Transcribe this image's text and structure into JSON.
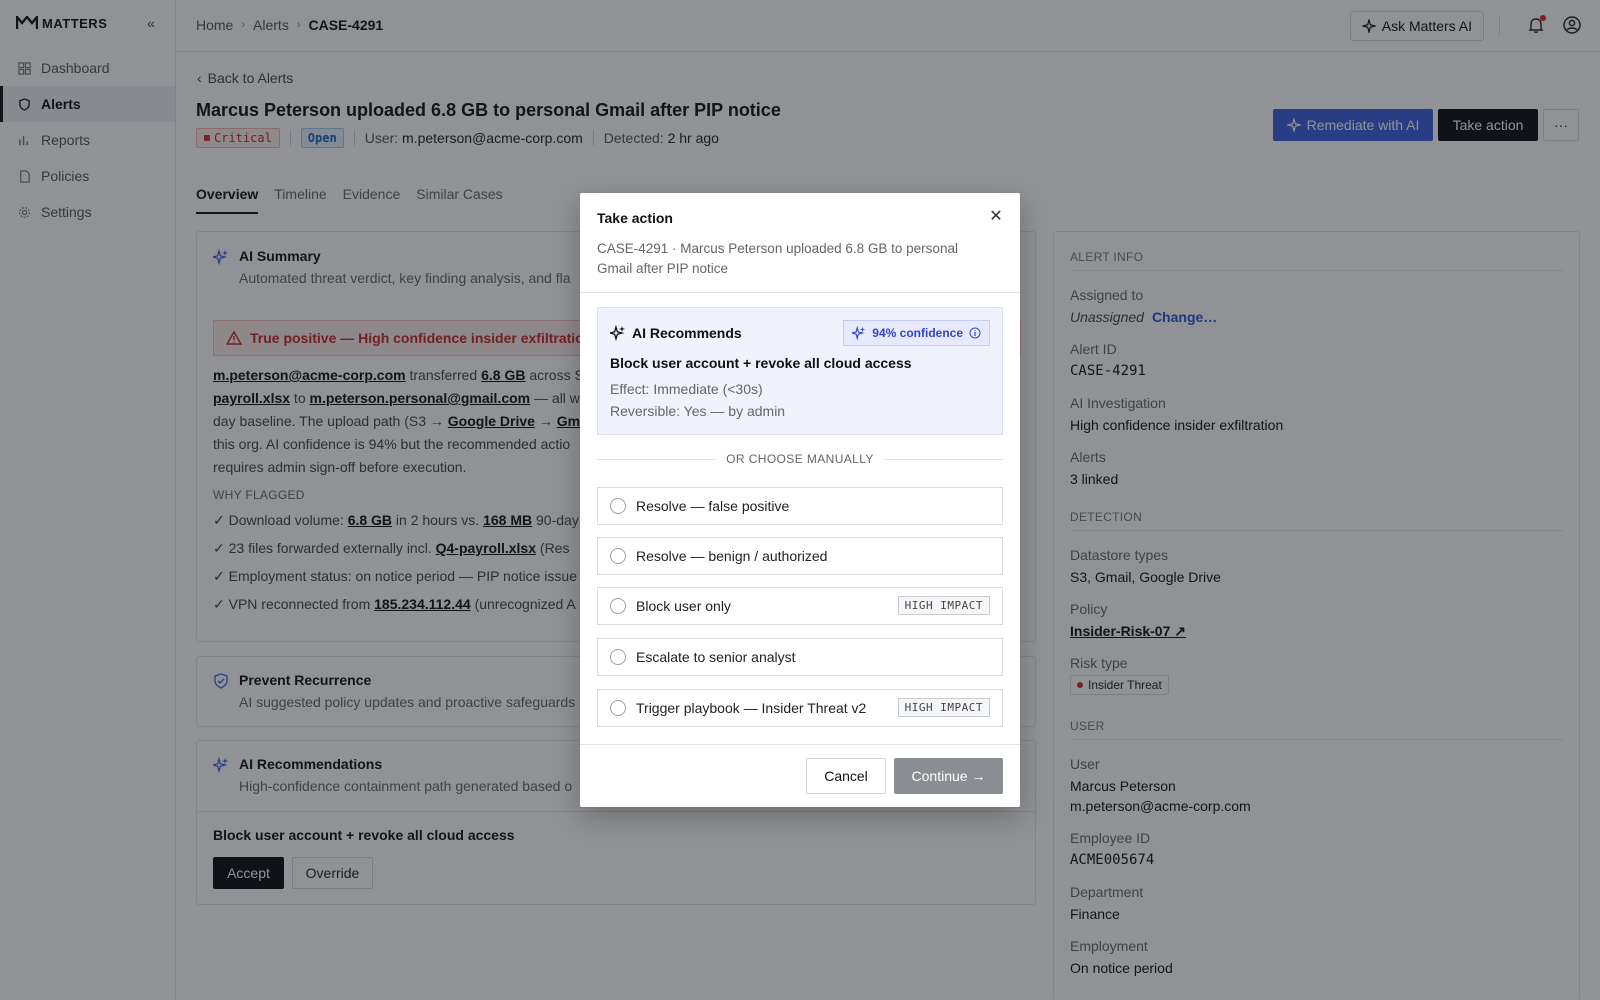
{
  "app": {
    "logo": "MATTERS"
  },
  "sidebar": {
    "items": [
      {
        "label": "Dashboard",
        "icon": "grid-icon"
      },
      {
        "label": "Alerts",
        "icon": "shield-icon"
      },
      {
        "label": "Reports",
        "icon": "bar-chart-icon"
      },
      {
        "label": "Policies",
        "icon": "document-icon"
      },
      {
        "label": "Settings",
        "icon": "gear-icon"
      }
    ]
  },
  "breadcrumb": [
    "Home",
    "Alerts",
    "CASE-4291"
  ],
  "topbar": {
    "ask_label": "Ask Matters AI"
  },
  "header": {
    "back_label": "Back to Alerts",
    "title": "Marcus Peterson uploaded 6.8 GB to personal Gmail after PIP notice",
    "severity": "Critical",
    "status": "Open",
    "user_label": "User:",
    "user_value": "m.peterson@acme-corp.com",
    "detected_label": "Detected:",
    "detected_value": "2 hr ago",
    "remediate_label": "Remediate with AI",
    "take_action_label": "Take action",
    "more_label": "···"
  },
  "tabs": [
    "Overview",
    "Timeline",
    "Evidence",
    "Similar Cases"
  ],
  "ai_summary": {
    "title": "AI Summary",
    "subtitle": "Automated threat verdict, key finding analysis, and fla",
    "verdict": "True positive — High confidence insider exfiltratio",
    "para": {
      "l1a": "m.peterson@acme-corp.com",
      "l1b": " transferred ",
      "l1c": "6.8 GB",
      "l1d": " across S",
      "l2a": "payroll.xlsx",
      "l2b": " to ",
      "l2c": "m.peterson.personal@gmail.com",
      "l2d": " — all w",
      "l3a": "day baseline. The upload path (S3 → ",
      "l3b": "Google Drive",
      "l3c": " → ",
      "l3d": "Gm",
      "l4": "this org. AI confidence is 94% but the recommended actio",
      "l5": "requires admin sign-off before execution."
    },
    "why_label": "WHY FLAGGED",
    "checks": [
      {
        "a": "Download volume: ",
        "b": "6.8 GB",
        "c": " in 2 hours vs. ",
        "d": "168 MB",
        "e": " 90-day"
      },
      {
        "a": "23 files forwarded externally incl. ",
        "b": "Q4-payroll.xlsx",
        "c": " (Res",
        "d": "",
        "e": ""
      },
      {
        "a": "Employment status: on notice period — PIP notice issue",
        "b": "",
        "c": "",
        "d": "",
        "e": ""
      },
      {
        "a": "VPN reconnected from ",
        "b": "185.234.112.44",
        "c": " (unrecognized A",
        "d": "",
        "e": ""
      }
    ]
  },
  "prevent": {
    "title": "Prevent Recurrence",
    "subtitle": "AI suggested policy updates and proactive safeguards"
  },
  "ai_recs": {
    "title": "AI Recommendations",
    "subtitle": "High-confidence containment path generated based o",
    "action": "Block user account + revoke all cloud access",
    "accept_label": "Accept",
    "override_label": "Override"
  },
  "alert_info": {
    "section": "ALERT INFO",
    "assigned_label": "Assigned to",
    "assigned_value": "Unassigned",
    "change_label": "Change…",
    "alert_id_label": "Alert ID",
    "alert_id_value": "CASE-4291",
    "investigation_label": "AI Investigation",
    "investigation_value": "High confidence insider exfiltration",
    "alerts_label": "Alerts",
    "alerts_value": "3 linked",
    "detection_section": "DETECTION",
    "datastore_label": "Datastore types",
    "datastore_value": "S3, Gmail, Google Drive",
    "policy_label": "Policy",
    "policy_value": "Insider-Risk-07 ↗",
    "risk_label": "Risk type",
    "risk_value": "Insider Threat",
    "user_section": "USER",
    "user_label": "User",
    "user_name": "Marcus Peterson",
    "user_email": "m.peterson@acme-corp.com",
    "employee_label": "Employee ID",
    "employee_value": "ACME005674",
    "dept_label": "Department",
    "dept_value": "Finance",
    "employment_label": "Employment",
    "employment_value": "On notice period"
  },
  "modal": {
    "title": "Take action",
    "subtitle": "CASE-4291 · Marcus Peterson uploaded 6.8 GB to personal Gmail after PIP notice",
    "rec_label": "AI Recommends",
    "confidence": "94% confidence",
    "rec_action": "Block user account + revoke all cloud access",
    "effect": "Effect: Immediate (<30s)",
    "reversible": "Reversible: Yes — by admin",
    "or_label": "OR CHOOSE MANUALLY",
    "options": [
      {
        "label": "Resolve — false positive",
        "tag": ""
      },
      {
        "label": "Resolve — benign / authorized",
        "tag": ""
      },
      {
        "label": "Block user only",
        "tag": "HIGH IMPACT"
      },
      {
        "label": "Escalate to senior analyst",
        "tag": ""
      },
      {
        "label": "Trigger playbook — Insider Threat v2",
        "tag": "HIGH IMPACT"
      }
    ],
    "cancel_label": "Cancel",
    "continue_label": "Continue →"
  }
}
